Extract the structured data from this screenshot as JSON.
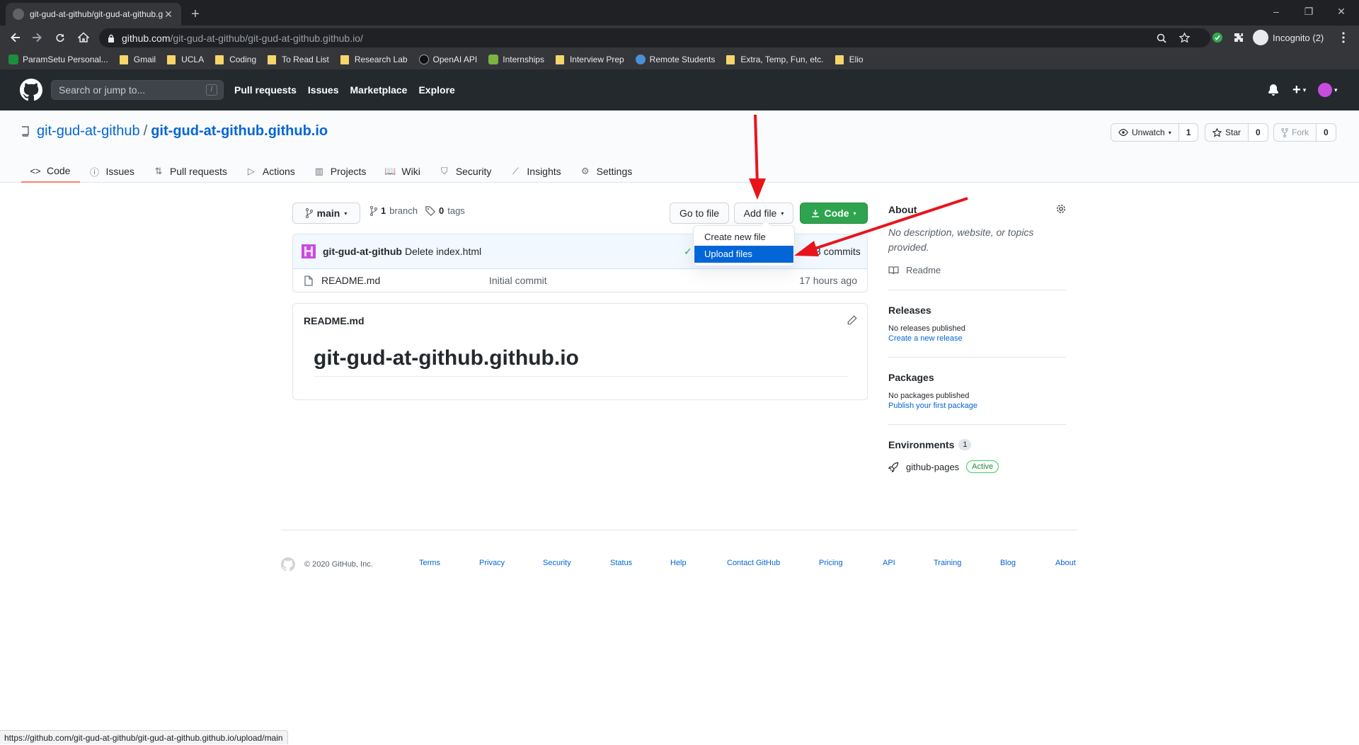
{
  "browser": {
    "tab_title": "git-gud-at-github/git-gud-at-github.github.io",
    "url_host": "github.com",
    "url_path": "/git-gud-at-github/git-gud-at-github.github.io/",
    "incognito_label": "Incognito (2)",
    "status_url": "https://github.com/git-gud-at-github/git-gud-at-github.github.io/upload/main",
    "bookmarks": [
      {
        "label": "ParamSetu Personal...",
        "icon": "green-plus-icon"
      },
      {
        "label": "Gmail",
        "icon": "folder-icon"
      },
      {
        "label": "UCLA",
        "icon": "folder-icon"
      },
      {
        "label": "Coding",
        "icon": "folder-icon"
      },
      {
        "label": "To Read List",
        "icon": "folder-icon"
      },
      {
        "label": "Research Lab",
        "icon": "folder-icon"
      },
      {
        "label": "OpenAI API",
        "icon": "openai-icon"
      },
      {
        "label": "Internships",
        "icon": "download-icon"
      },
      {
        "label": "Interview Prep",
        "icon": "folder-icon"
      },
      {
        "label": "Remote Students",
        "icon": "globe-icon"
      },
      {
        "label": "Extra, Temp, Fun, etc.",
        "icon": "folder-icon"
      },
      {
        "label": "Elio",
        "icon": "folder-icon"
      }
    ]
  },
  "gh_header": {
    "search_placeholder": "Search or jump to...",
    "search_key": "/",
    "nav": [
      "Pull requests",
      "Issues",
      "Marketplace",
      "Explore"
    ]
  },
  "repo": {
    "owner": "git-gud-at-github",
    "separator": "/",
    "name": "git-gud-at-github.github.io",
    "unwatch_label": "Unwatch",
    "watch_count": "1",
    "star_label": "Star",
    "star_count": "0",
    "fork_label": "Fork",
    "fork_count": "0",
    "tabs": [
      "Code",
      "Issues",
      "Pull requests",
      "Actions",
      "Projects",
      "Wiki",
      "Security",
      "Insights",
      "Settings"
    ]
  },
  "main": {
    "branch": "main",
    "branch_count": "1",
    "branch_word": "branch",
    "tag_count": "0",
    "tag_word": "tags",
    "go_to_file": "Go to file",
    "add_file": "Add file",
    "code_button": "Code",
    "dropdown": [
      "Create new file",
      "Upload files"
    ],
    "commit_author": "git-gud-at-github",
    "commit_message": "Delete index.html",
    "commits_label": "3 commits",
    "files": [
      {
        "name": "README.md",
        "message": "Initial commit",
        "age": "17 hours ago"
      }
    ],
    "readme_file": "README.md",
    "readme_heading": "git-gud-at-github.github.io"
  },
  "sidebar": {
    "about_title": "About",
    "about_desc": "No description, website, or topics provided.",
    "readme_label": "Readme",
    "releases_title": "Releases",
    "releases_none": "No releases published",
    "releases_link": "Create a new release",
    "packages_title": "Packages",
    "packages_none": "No packages published",
    "packages_link": "Publish your first package",
    "env_title": "Environments",
    "env_count": "1",
    "env_name": "github-pages",
    "env_status": "Active"
  },
  "footer": {
    "copyright": "© 2020 GitHub, Inc.",
    "links": [
      "Terms",
      "Privacy",
      "Security",
      "Status",
      "Help",
      "Contact GitHub",
      "Pricing",
      "API",
      "Training",
      "Blog",
      "About"
    ]
  },
  "colors": {
    "annotation_arrow": "#e8141c",
    "code_button": "#2ea44f",
    "link": "#0366d6",
    "dropdown_highlight": "#0366d6"
  }
}
